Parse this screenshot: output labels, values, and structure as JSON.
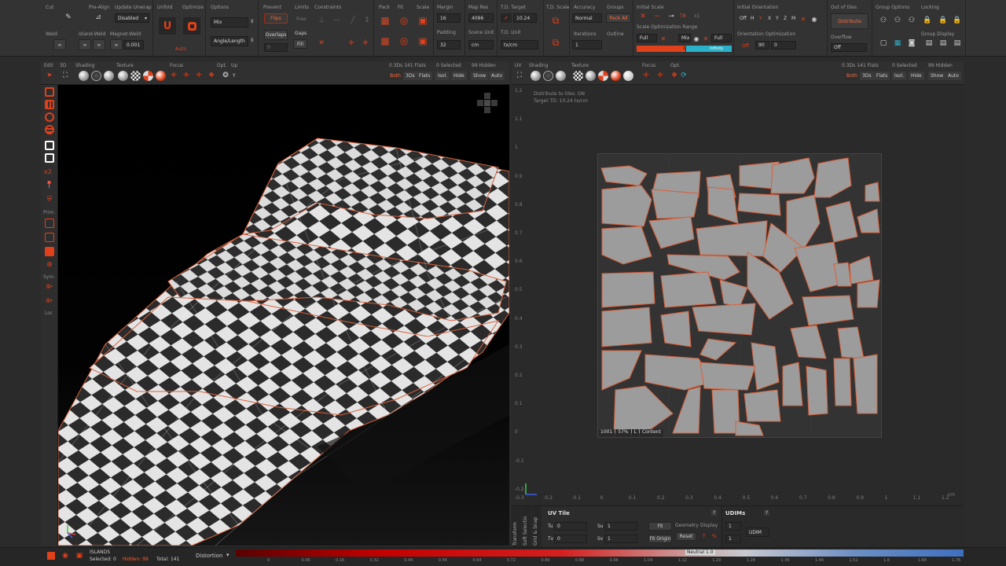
{
  "ribbon": {
    "cut": {
      "title": "Cut",
      "weld": "Weld"
    },
    "prealign": {
      "title": "Pre-Align",
      "island_weld": "Island-Weld"
    },
    "update_unwrap": {
      "title": "Update Unwrap",
      "value": "Disabled",
      "magnet_weld": "Magnet-Weld",
      "magnet_value": "0.001"
    },
    "unfold": {
      "title": "Unfold"
    },
    "optimize": {
      "title": "Optimize",
      "auto": "Auto"
    },
    "options": {
      "title": "Options",
      "mode": "Mix",
      "angle": "Angle/Length"
    },
    "prevent": {
      "title": "Prevent",
      "flips": "Flips",
      "overlaps": "Overlaps",
      "value": "0"
    },
    "limits": {
      "title": "Limits",
      "free": "Free",
      "gaps": "Gaps",
      "fill": "Fill"
    },
    "constraints": {
      "title": "Constraints"
    },
    "pack": {
      "title": "Pack"
    },
    "fit": {
      "title": "Fit"
    },
    "scale": {
      "title": "Scale"
    },
    "margin": {
      "title": "Margin",
      "value": "16",
      "padding": "Padding",
      "padding_value": "32"
    },
    "mapres": {
      "title": "Map Res",
      "value": "4096",
      "scene_unit": "Scene Unit",
      "unit_value": "cm"
    },
    "td_target": {
      "title": "T.D. Target",
      "value": "10.24",
      "unit": "T.D. Unit",
      "unit_value": "tx/cm"
    },
    "td_scale": {
      "title": "T.D. Scale"
    },
    "accuracy": {
      "title": "Accuracy",
      "value": "Normal",
      "iterations": "Iterations",
      "iter_value": "1"
    },
    "groups": {
      "title": "Groups",
      "pack_all": "Pack All",
      "outline": "Outline"
    },
    "initial_scale": {
      "title": "Initial Scale",
      "range": "Scale Optimization Range",
      "full": "Full",
      "mix": "Mix",
      "full2": "Full",
      "range_start": "1",
      "range_end": "Infinity"
    },
    "initial_orientation": {
      "title": "Initial Orientation",
      "off": "Off",
      "h": "H",
      "y": "Y",
      "x": "X",
      "y2": "Y",
      "z": "Z",
      "m": "M",
      "orient_opt": "Orientation Optimization",
      "off2": "Off",
      "deg": "90",
      "val": "0"
    },
    "out_of_tiles": {
      "title": "Out of tiles",
      "distribute": "Distribute",
      "overflow": "Overflow",
      "overflow_value": "Off"
    },
    "group_options": {
      "title": "Group Options"
    },
    "locking": {
      "title": "Locking",
      "group_display": "Group Display"
    }
  },
  "view3d": {
    "edit": "Edit",
    "d3": "3D",
    "shading": "Shading",
    "texture": "Texture",
    "focus": "Focus",
    "opt": "Opt.",
    "up": "Up",
    "up_value": "Y",
    "stats": "0.3Ds 141 Flats",
    "selected": "0 Selected",
    "hidden": "99 Hidden",
    "both": "Both",
    "ds3": "3Ds",
    "flats": "Flats",
    "isol": "Isol.",
    "hide": "Hide",
    "show": "Show",
    "auto": "Auto"
  },
  "viewuv": {
    "uv": "UV",
    "shading": "Shading",
    "texture": "Texture",
    "focus": "Focus",
    "opt": "Opt.",
    "stats": "0.3Ds 141 Flats",
    "selected": "0 Selected",
    "hidden": "99 Hidden",
    "both": "Both",
    "ds3": "3Ds",
    "flats": "Flats",
    "isol": "Isol.",
    "hide": "Hide",
    "show": "Show",
    "auto": "Auto",
    "info1": "Distribute to tiles: ON",
    "info2": "Target TD: 10.24 tx/cm",
    "tile_id": "1001",
    "tile_pct": "57%",
    "tile_l": "L",
    "tile_content": "Content",
    "yticks": [
      "1.2",
      "1.1",
      "1",
      "0.9",
      "0.8",
      "0.7",
      "0.6",
      "0.5",
      "0.4",
      "0.3",
      "0.2",
      "0.1",
      "0",
      "-0.1",
      "-0.2"
    ],
    "xticks": [
      "-0.3",
      "-0.2",
      "-0.1",
      "0",
      "0.1",
      "0.2",
      "0.3",
      "0.4",
      "0.5",
      "0.6",
      "0.7",
      "0.8",
      "0.9",
      "1",
      "1.1",
      "1.2"
    ],
    "unit": "cm"
  },
  "left_tools": {
    "prim": "Prim.",
    "sym": "Sym.",
    "loc": "Loc",
    "x2": "x2"
  },
  "uvtile": {
    "vertical_tabs": [
      "Transform",
      "Soft Selectio",
      "Grid & Snap"
    ],
    "title": "UV Tile",
    "tu_label": "Tu",
    "tu_value": "0",
    "tv_label": "Tv",
    "tv_value": "0",
    "su_label": "Su",
    "su_value": "1",
    "sv_label": "Sv",
    "sv_value": "1",
    "fit": "Fit",
    "fit_origin": "Fit Origin",
    "geometry": "Geometry",
    "reset": "Reset",
    "display": "Display",
    "t": "T",
    "pct": "%",
    "udims_title": "UDIMs",
    "udims_a": "1",
    "udims_b": "1",
    "udim": "UDIM",
    "help": "?"
  },
  "status": {
    "islands": "ISLANDS",
    "selected": "Selected: 0",
    "hidden": "Hidden: 99",
    "total": "Total: 141",
    "distortion": "Distortion",
    "neutral": "Neutral 1.0",
    "ticks": [
      "0",
      "0.06",
      "0.16",
      "0.32",
      "0.44",
      "0.56",
      "0.64",
      "0.72",
      "0.80",
      "0.88",
      "0.96",
      "1.04",
      "1.12",
      "1.20",
      "1.28",
      "1.36",
      "1.44",
      "1.52",
      "1.6",
      "1.68",
      "1.76"
    ]
  },
  "colors": {
    "accent": "#e0401a",
    "uv_island": "#9c9c9c",
    "island_edge": "#d9603a",
    "blue_range": "#3e6fc0"
  }
}
